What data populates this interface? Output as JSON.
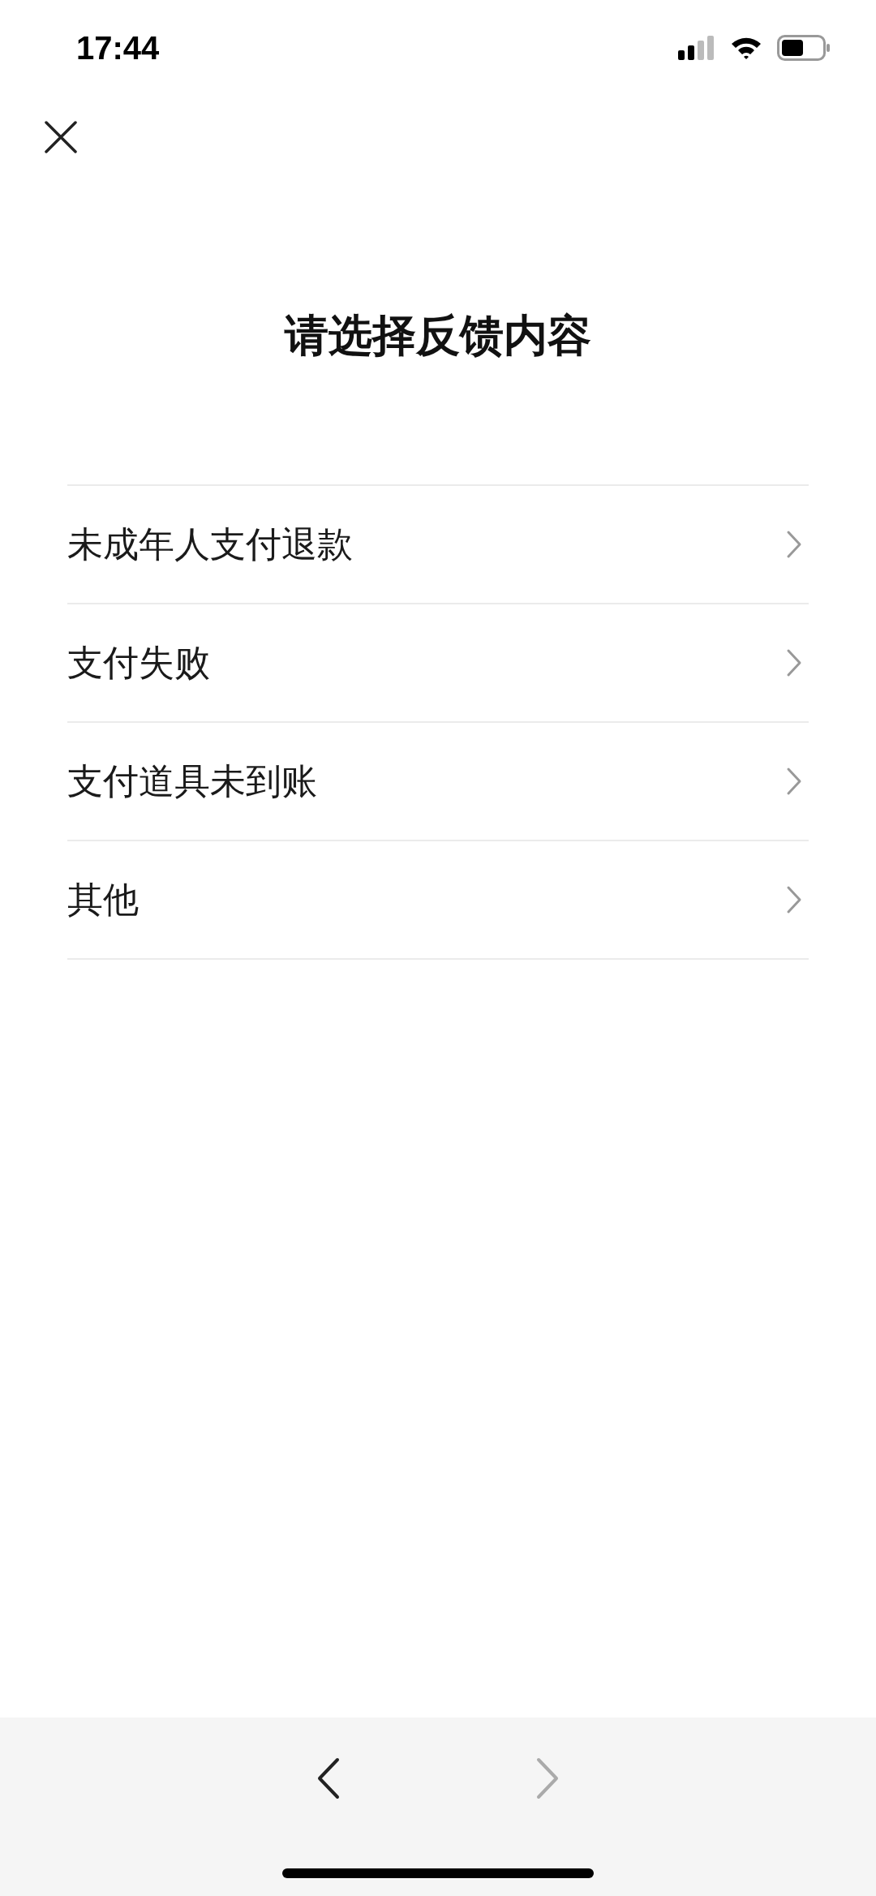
{
  "status_bar": {
    "time": "17:44"
  },
  "title": "请选择反馈内容",
  "options": [
    {
      "label": "未成年人支付退款"
    },
    {
      "label": "支付失败"
    },
    {
      "label": "支付道具未到账"
    },
    {
      "label": "其他"
    }
  ],
  "nav": {
    "back": {
      "disabled": false
    },
    "forward": {
      "disabled": true
    }
  }
}
